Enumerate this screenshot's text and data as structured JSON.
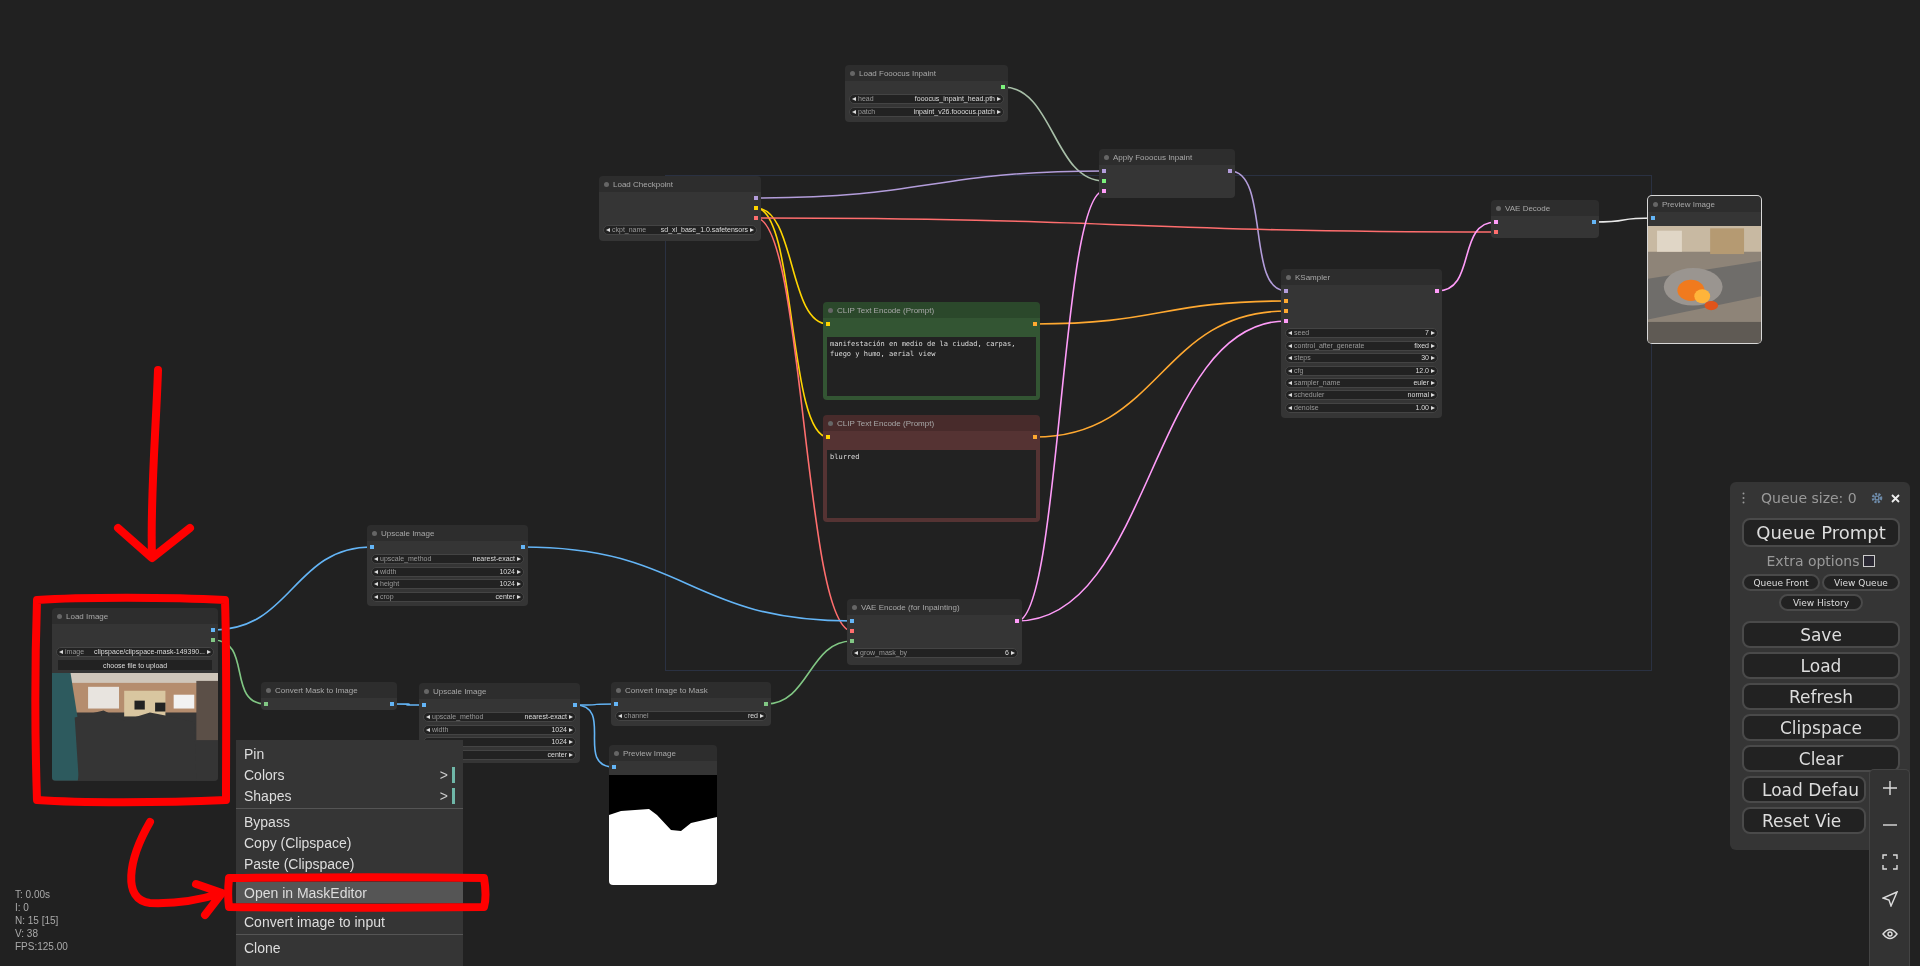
{
  "canvas": {
    "nodes": [
      {
        "title": "Load Fooocus Inpaint",
        "kind": "plain",
        "color": "#353535",
        "selected": false,
        "widgets": [
          {
            "name": "head",
            "value": "fooocus_inpaint_head.pth"
          },
          {
            "name": "patch",
            "value": "inpaint_v26.fooocus.patch"
          }
        ]
      },
      {
        "title": "Load Checkpoint",
        "kind": "plain",
        "color": "#353535",
        "selected": false,
        "widgets": [
          {
            "name": "ckpt_name",
            "value": "sd_xl_base_1.0.safetensors"
          }
        ]
      },
      {
        "title": "Apply Fooocus Inpaint",
        "kind": "plain",
        "color": "#353535",
        "selected": false
      },
      {
        "title": "CLIP Text Encode (Prompt)",
        "kind": "prompt",
        "color": "#335533",
        "selected": false,
        "prompt": "manifestación en medio de la ciudad, carpas, fuego y humo, aerial view"
      },
      {
        "title": "CLIP Text Encode (Prompt)",
        "kind": "prompt",
        "color": "#553333",
        "selected": false,
        "prompt": "blurred"
      },
      {
        "title": "KSampler",
        "kind": "plain",
        "color": "#353535",
        "selected": false,
        "widgets": [
          {
            "name": "seed",
            "value": "7"
          },
          {
            "name": "control_after_generate",
            "value": "fixed"
          },
          {
            "name": "steps",
            "value": "30"
          },
          {
            "name": "cfg",
            "value": "12.0"
          },
          {
            "name": "sampler_name",
            "value": "euler"
          },
          {
            "name": "scheduler",
            "value": "normal"
          },
          {
            "name": "denoise",
            "value": "1.00"
          }
        ]
      },
      {
        "title": "VAE Decode",
        "kind": "plain",
        "color": "#353535",
        "selected": false
      },
      {
        "title": "Preview Image",
        "color": "#353535",
        "selected": true
      },
      {
        "title": "Upscale Image",
        "kind": "plain",
        "color": "#353535",
        "selected": false,
        "widgets": [
          {
            "name": "upscale_method",
            "value": "nearest-exact"
          },
          {
            "name": "width",
            "value": "1024"
          },
          {
            "name": "height",
            "value": "1024"
          },
          {
            "name": "crop",
            "value": "center"
          }
        ]
      },
      {
        "title": "Load Image",
        "color": "#353535",
        "selected": false,
        "widgets": [
          {
            "name": "image",
            "value": "clipspace/clipspace-mask-149390..."
          }
        ],
        "upload_button": "choose file to upload"
      },
      {
        "title": "Convert Mask to Image",
        "kind": "plain",
        "color": "#353535",
        "selected": false
      },
      {
        "title": "Upscale Image",
        "kind": "plain",
        "color": "#353535",
        "selected": false,
        "widgets": [
          {
            "name": "upscale_method",
            "value": "nearest-exact"
          },
          {
            "name": "width",
            "value": "1024"
          },
          {
            "value": "1024"
          },
          {
            "value": "center"
          }
        ]
      },
      {
        "title": "Convert Image to Mask",
        "kind": "plain",
        "color": "#353535",
        "selected": false,
        "widgets": [
          {
            "name": "channel",
            "value": "red"
          }
        ]
      },
      {
        "title": "Preview Image",
        "color": "#353535",
        "selected": false
      },
      {
        "title": "VAE Encode (for Inpainting)",
        "kind": "plain",
        "color": "#353535",
        "selected": false,
        "widgets": [
          {
            "name": "grow_mask_by",
            "value": "6"
          }
        ]
      }
    ]
  },
  "context_menu": {
    "items": [
      {
        "label": "Pin",
        "selected": false
      },
      {
        "label": "Colors",
        "selected": false,
        "arrow": ">"
      },
      {
        "label": "Shapes",
        "selected": false,
        "arrow": ">"
      },
      {
        "label": "Bypass",
        "selected": false,
        "separator_before": true
      },
      {
        "label": "Copy (Clipspace)",
        "selected": false
      },
      {
        "label": "Paste (Clipspace)",
        "selected": false
      },
      {
        "label": "Open in MaskEditor",
        "selected": true
      },
      {
        "label": "Convert image to input",
        "selected": false
      },
      {
        "label": "Clone",
        "selected": false,
        "separator_before": true
      }
    ]
  },
  "stats": [
    "T: 0.00s",
    "I: 0",
    "N: 15 [15]",
    "V: 38",
    "FPS:125.00"
  ],
  "queue_panel": {
    "title": "Queue size: 0",
    "queue_button": "Queue Prompt",
    "extra_options": {
      "label": "Extra options",
      "checked": false
    },
    "small_buttons": [
      "Queue Front",
      "View Queue",
      "View History"
    ],
    "buttons": [
      "Save",
      "Load",
      "Refresh",
      "Clipspace",
      "Clear",
      "Load Defau",
      "Reset Vie"
    ]
  }
}
